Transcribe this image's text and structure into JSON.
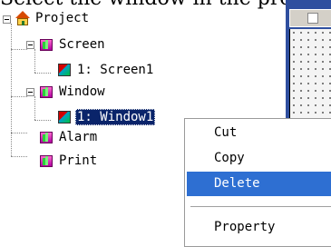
{
  "caption": "Select the window in the project",
  "tree": {
    "root": {
      "label": "Project",
      "icon": "house-icon"
    },
    "nodes": [
      {
        "label": "Screen",
        "icon": "folder-icon"
      },
      {
        "label": "1: Screen1",
        "icon": "screen-icon"
      },
      {
        "label": "Window",
        "icon": "folder-icon"
      },
      {
        "label": "1: Window1",
        "icon": "screen-icon",
        "selected": true
      },
      {
        "label": "Alarm",
        "icon": "folder-icon"
      },
      {
        "label": "Print",
        "icon": "folder-icon"
      }
    ]
  },
  "context_menu": {
    "items": [
      {
        "label": "Cut"
      },
      {
        "label": "Copy"
      },
      {
        "label": "Delete",
        "highlighted": true
      },
      {
        "label": "Property"
      }
    ],
    "highlight_color": "#2e6fd2"
  },
  "colors": {
    "selection": "#0a246a",
    "editor_frame": "#2f4f9f"
  }
}
